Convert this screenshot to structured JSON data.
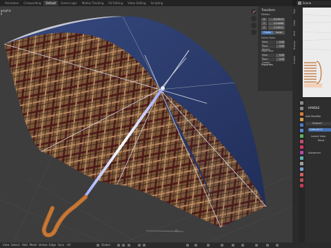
{
  "workspace_tabs": [
    "Animation",
    "Compositing",
    "Default",
    "Game Logic",
    "Motion Tracking",
    "UV Editing",
    "Video Editing",
    "Scripting"
  ],
  "active_tab_index": 2,
  "scene": {
    "name": "Scene"
  },
  "viewport": {
    "info_line1": "graphic",
    "info_line2": "ll"
  },
  "npanel": {
    "header": "Transform",
    "median_label": "Median:",
    "axes": [
      {
        "axis": "X",
        "value": "-0.24114"
      },
      {
        "axis": "Y",
        "value": "0.24006"
      },
      {
        "axis": "Z",
        "value": "2.10111"
      }
    ],
    "global_label": "Global",
    "local_label": "Local",
    "vertex_data_label": "Vertex Data:",
    "vertex_rows": [
      {
        "label": "Mean Bevel:",
        "value": "0.00"
      },
      {
        "label": "Mean Weight:",
        "value": "0.00"
      }
    ],
    "edge_data_label": "Edge Data:",
    "edge_rows": [
      {
        "label": "Mean Bevel:",
        "value": "0.00"
      },
      {
        "label": "Mean Crease:",
        "value": "0.00"
      }
    ],
    "properties_label": "Properties"
  },
  "right_tabs": [
    "Tool",
    "View",
    "Edit",
    "Display",
    "Create"
  ],
  "props": {
    "object_name": "HANDLE",
    "add_modifier": "Add Modifier",
    "modifier_name": "Subsurf",
    "field1": "Catmull-Cl",
    "field2": "Levels View",
    "field3": "Rend",
    "advanced": "Advanced"
  },
  "bottombar": {
    "items": [
      "View",
      "Select",
      "Add",
      "Mesh",
      "Vertex",
      "Edge",
      "Face",
      "UV"
    ],
    "transform_orientation": "Global"
  },
  "colors": {
    "canopy_blue": "#2d3e70",
    "plaid_base": "#7a5538",
    "plaid_red": "#5a1a18",
    "handle": "#b86a2c",
    "accent_blue": "#4772b3"
  }
}
